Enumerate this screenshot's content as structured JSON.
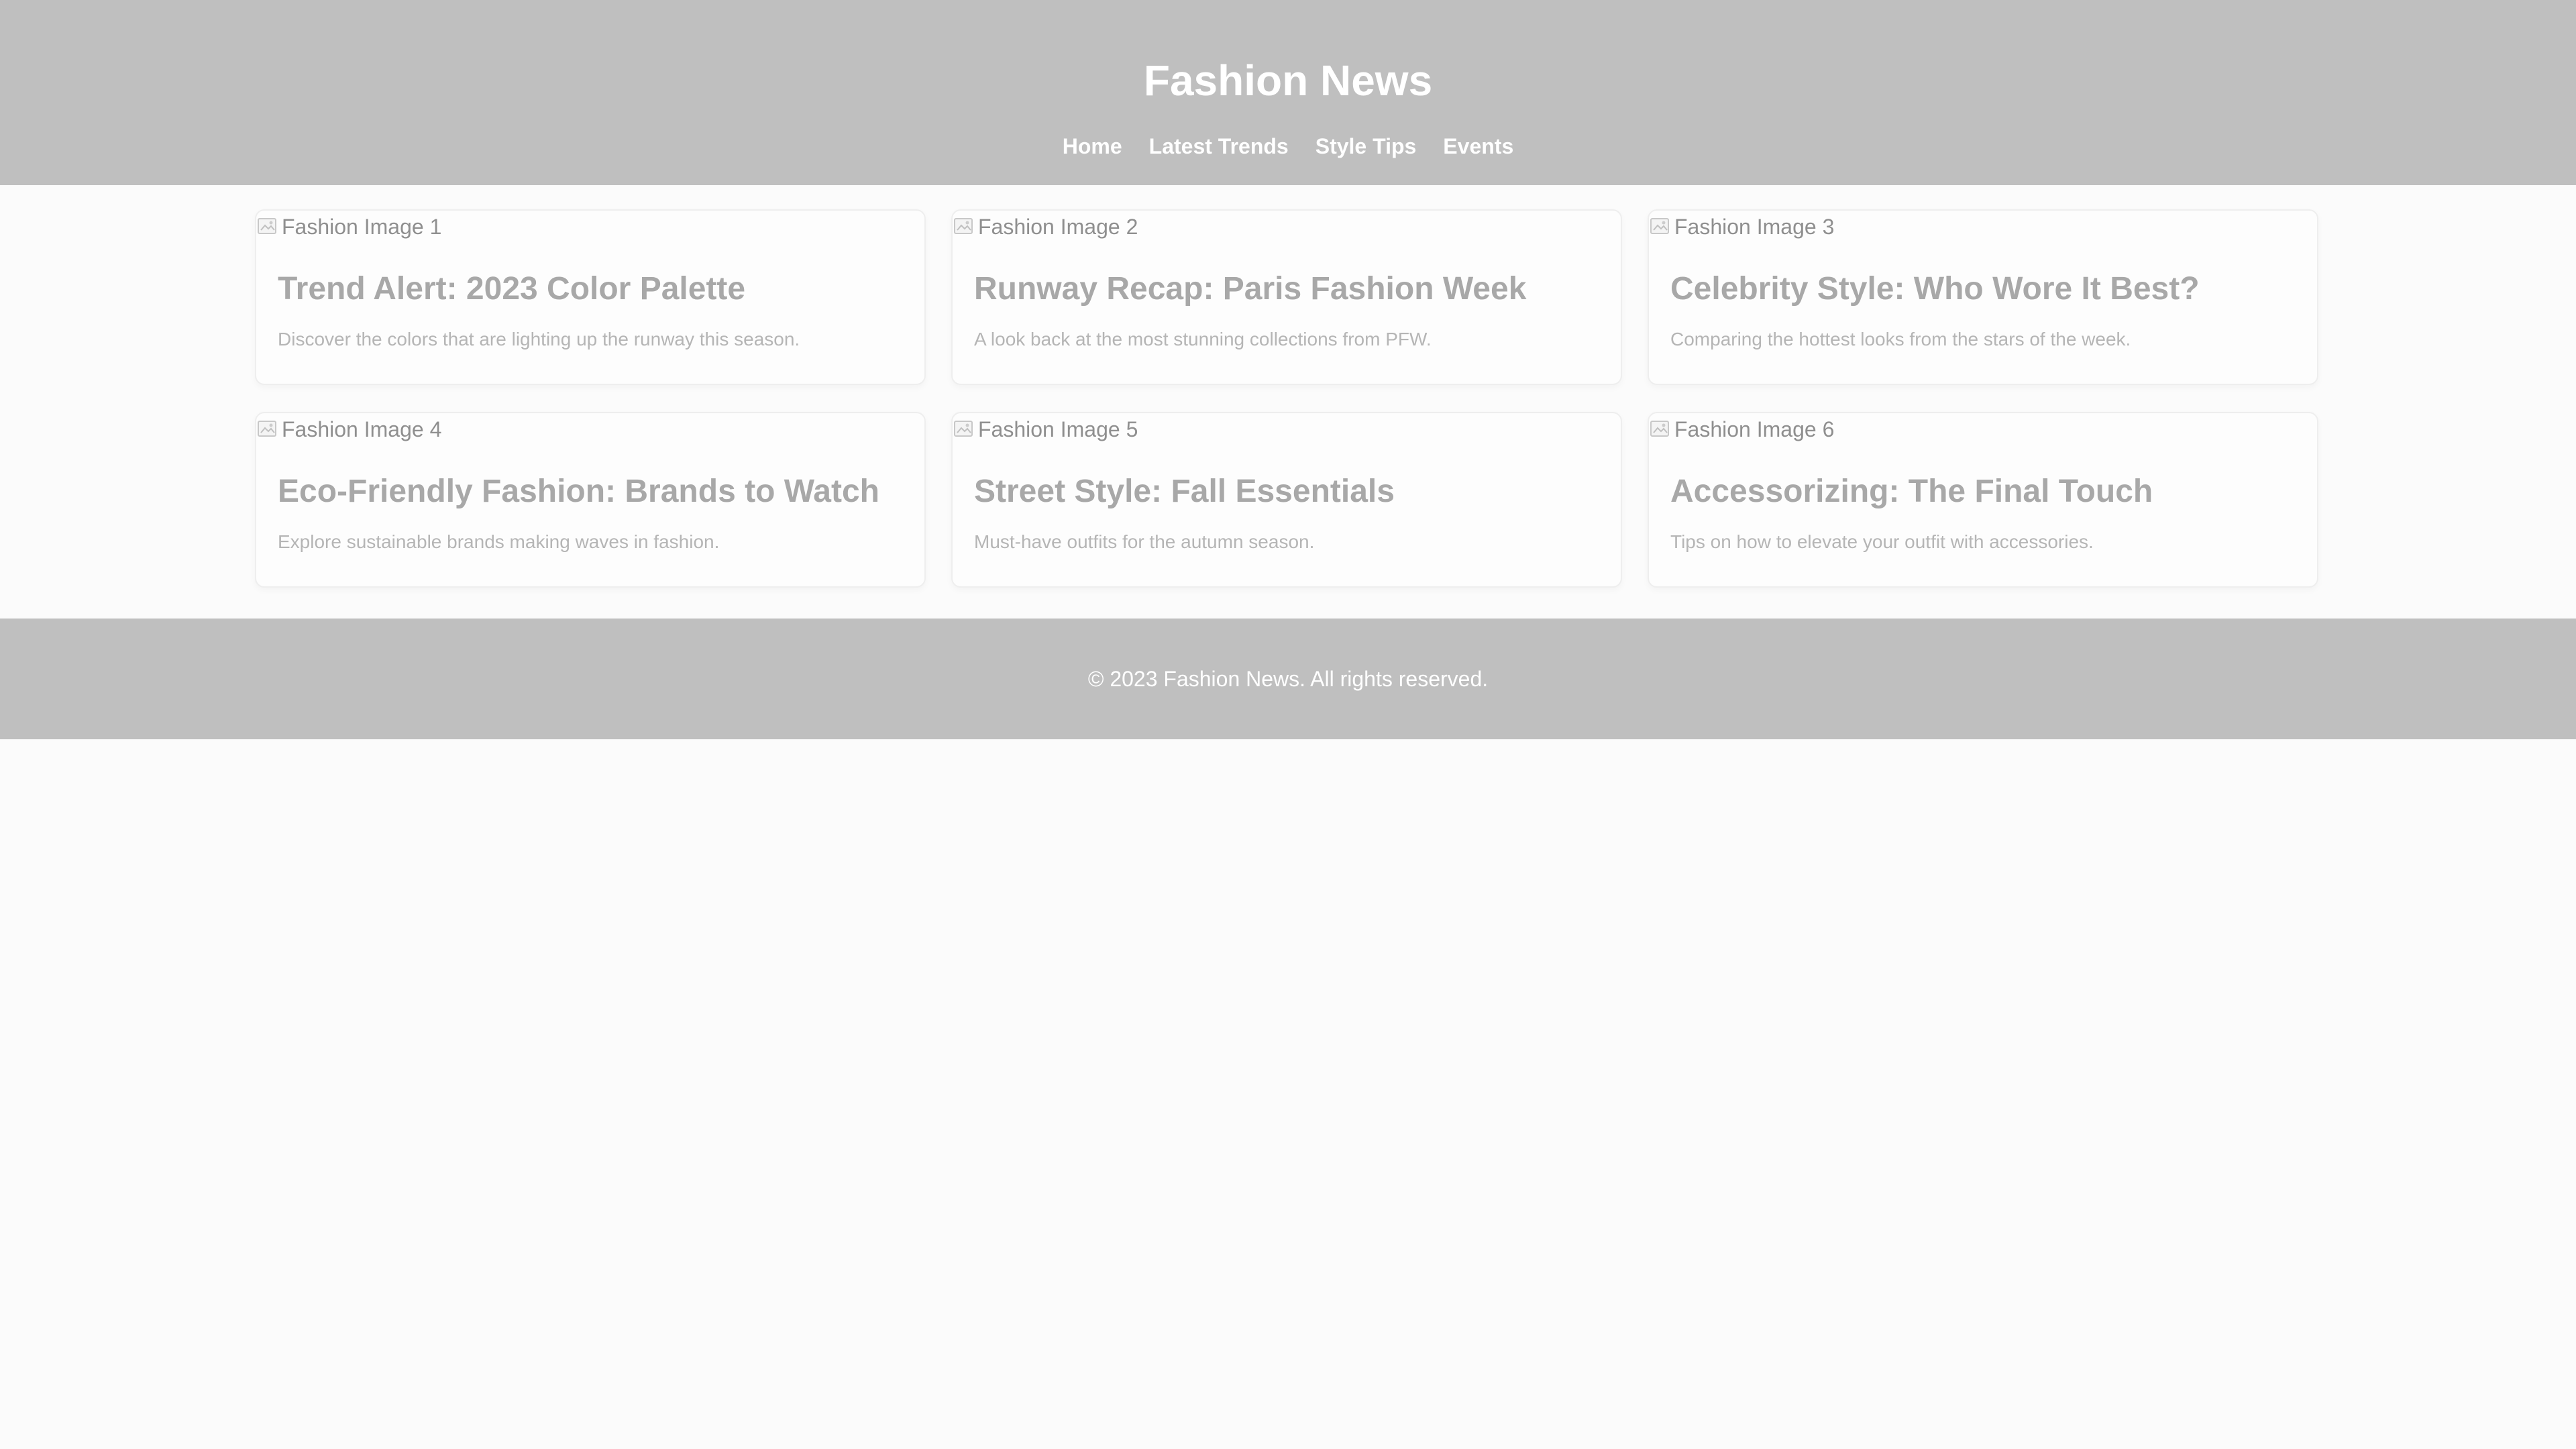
{
  "header": {
    "title": "Fashion News",
    "nav": [
      {
        "label": "Home"
      },
      {
        "label": "Latest Trends"
      },
      {
        "label": "Style Tips"
      },
      {
        "label": "Events"
      }
    ]
  },
  "articles": [
    {
      "image_alt": "Fashion Image 1",
      "title": "Trend Alert: 2023 Color Palette",
      "description": "Discover the colors that are lighting up the runway this season."
    },
    {
      "image_alt": "Fashion Image 2",
      "title": "Runway Recap: Paris Fashion Week",
      "description": "A look back at the most stunning collections from PFW."
    },
    {
      "image_alt": "Fashion Image 3",
      "title": "Celebrity Style: Who Wore It Best?",
      "description": "Comparing the hottest looks from the stars of the week."
    },
    {
      "image_alt": "Fashion Image 4",
      "title": "Eco-Friendly Fashion: Brands to Watch",
      "description": "Explore sustainable brands making waves in fashion."
    },
    {
      "image_alt": "Fashion Image 5",
      "title": "Street Style: Fall Essentials",
      "description": "Must-have outfits for the autumn season."
    },
    {
      "image_alt": "Fashion Image 6",
      "title": "Accessorizing: The Final Touch",
      "description": "Tips on how to elevate your outfit with accessories."
    }
  ],
  "footer": {
    "copyright": "© 2023 Fashion News. All rights reserved."
  },
  "colors": {
    "header_bg": "#bfbfbf",
    "page_bg": "#fbfbfb",
    "title_text": "#a8a8a8"
  },
  "icons": {
    "image_placeholder": "broken-image-icon"
  }
}
